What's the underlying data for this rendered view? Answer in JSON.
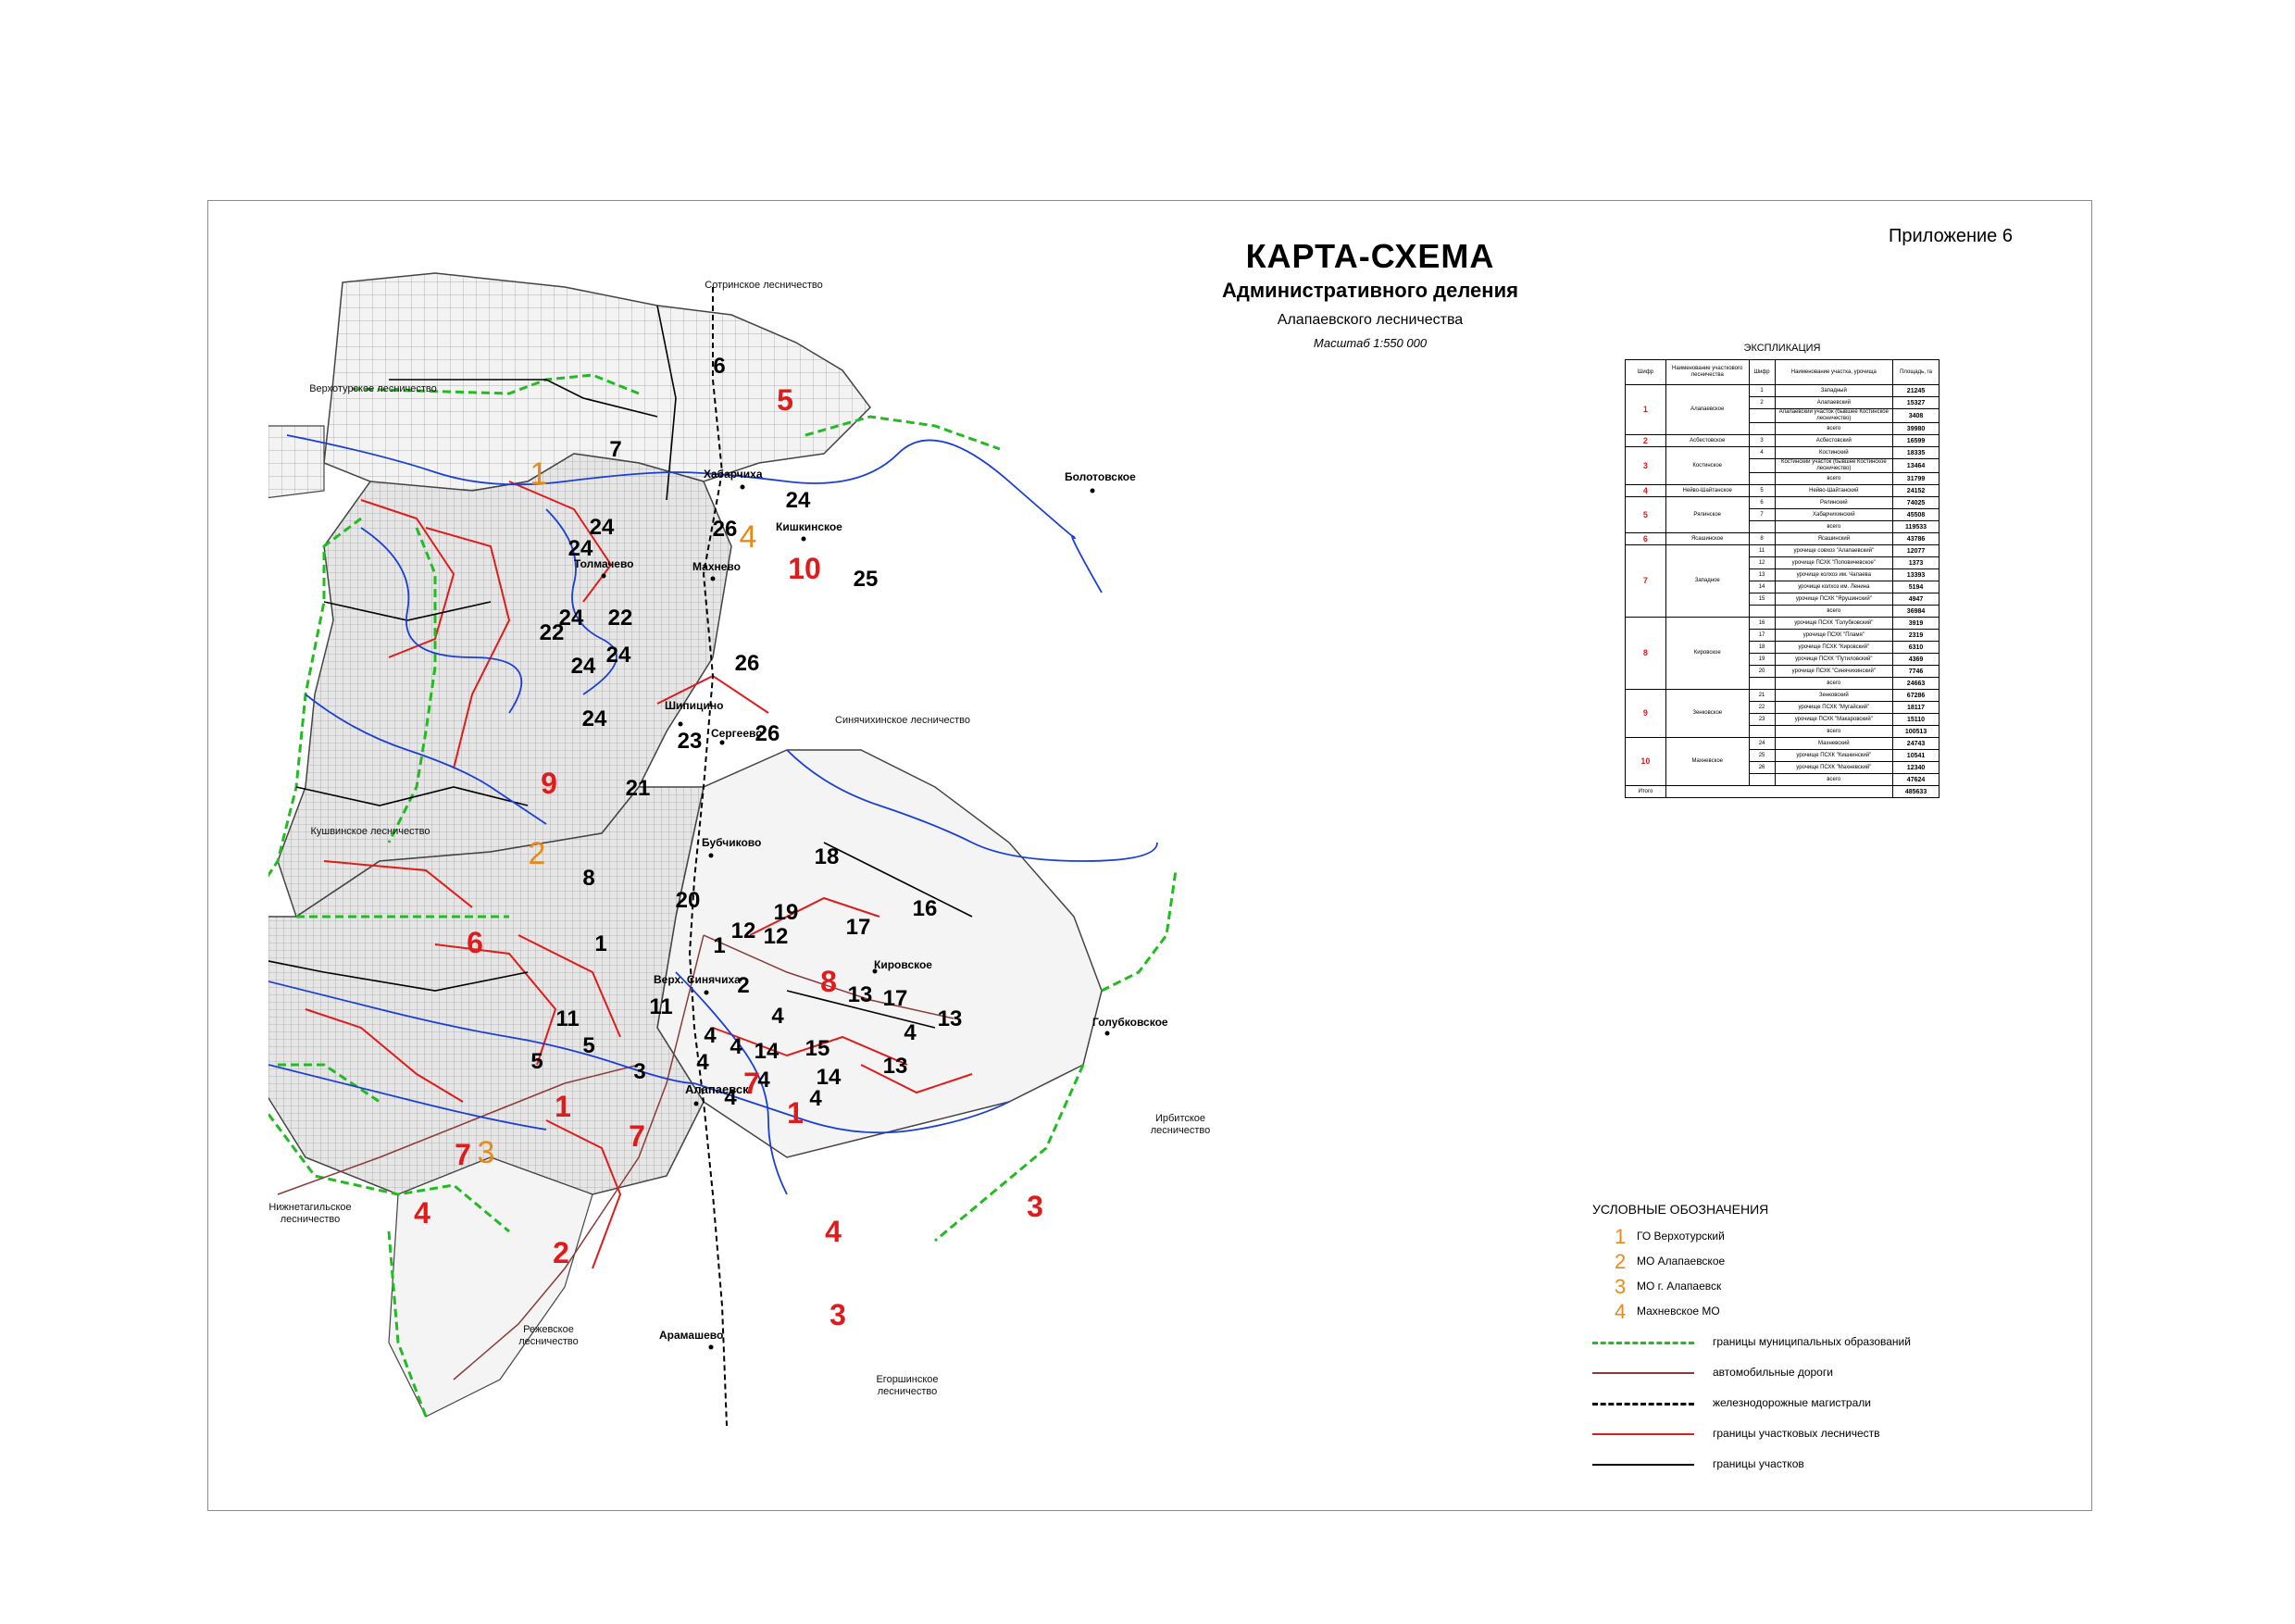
{
  "header": {
    "appendix": "Приложение 6",
    "title": "КАРТА-СХЕМА",
    "subtitle": "Административного деления",
    "subtitle2": "Алапаевского лесничества",
    "scale": "Масштаб 1:550 000"
  },
  "neighbors": [
    {
      "text": "Сотринское лесничество"
    },
    {
      "text": "Верхотурское лесничество"
    },
    {
      "text": "Кушвинское лесничество"
    },
    {
      "text": "Синячихинское лесничество"
    },
    {
      "text": "Ирбитское лесничество"
    },
    {
      "text": "Нижнетагильское лесничество"
    },
    {
      "text": "Режевское лесничество"
    },
    {
      "text": "Егоршинское лесничество"
    }
  ],
  "towns": [
    {
      "text": "Хабарчиха"
    },
    {
      "text": "Кишкинское"
    },
    {
      "text": "Болотовское"
    },
    {
      "text": "Толмачево"
    },
    {
      "text": "Махнево"
    },
    {
      "text": "Шипицино"
    },
    {
      "text": "Сергеево"
    },
    {
      "text": "Бубчиково"
    },
    {
      "text": "Верх. Синячиха"
    },
    {
      "text": "Кировское"
    },
    {
      "text": "Голубковское"
    },
    {
      "text": "Алапаевск"
    },
    {
      "text": "Арамашево"
    }
  ],
  "map_labels": {
    "municipal": [
      "1",
      "2",
      "3",
      "4"
    ],
    "forestries": [
      "1",
      "2",
      "3",
      "4",
      "5",
      "6",
      "7",
      "7",
      "7",
      "8",
      "9",
      "10",
      "1",
      "3",
      "4"
    ],
    "sections": [
      "6",
      "7",
      "24",
      "24",
      "24",
      "22",
      "22",
      "24",
      "24",
      "24",
      "26",
      "26",
      "24",
      "26",
      "23",
      "21",
      "8",
      "20",
      "18",
      "19",
      "16",
      "17",
      "12",
      "12",
      "1",
      "1",
      "2",
      "11",
      "11",
      "5",
      "5",
      "3",
      "4",
      "4",
      "4",
      "4",
      "4",
      "14",
      "15",
      "14",
      "4",
      "13",
      "17",
      "13",
      "13",
      "4",
      "4",
      "25"
    ]
  },
  "explication": {
    "title": "ЭКСПЛИКАЦИЯ",
    "headers": [
      "Шифр",
      "Наименование участкового лесничества",
      "Шифр",
      "Наименование участка, урочища",
      "Площадь, га"
    ],
    "groups": [
      {
        "cipher": "1",
        "name": "Алапаевское",
        "rows": [
          {
            "sub": "1",
            "name": "Западный",
            "area": "21245"
          },
          {
            "sub": "2",
            "name": "Алапаевский",
            "area": "15327"
          },
          {
            "sub": "",
            "name": "Алапаевский участок (бывшее Костинское лесничество)",
            "area": "3408"
          },
          {
            "sub": "",
            "name": "всего",
            "area": "39980"
          }
        ]
      },
      {
        "cipher": "2",
        "name": "Асбестовское",
        "rows": [
          {
            "sub": "3",
            "name": "Асбестовский",
            "area": "16599"
          }
        ]
      },
      {
        "cipher": "3",
        "name": "Костинское",
        "rows": [
          {
            "sub": "4",
            "name": "Костинский",
            "area": "18335"
          },
          {
            "sub": "",
            "name": "Костинский участок (бывшее Костинское лесничество)",
            "area": "13464"
          },
          {
            "sub": "",
            "name": "всего",
            "area": "31799"
          }
        ]
      },
      {
        "cipher": "4",
        "name": "Нейво-Шайтанское",
        "rows": [
          {
            "sub": "5",
            "name": "Нейво-Шайтанский",
            "area": "24152"
          }
        ]
      },
      {
        "cipher": "5",
        "name": "Рялинское",
        "rows": [
          {
            "sub": "6",
            "name": "Рялинский",
            "area": "74025"
          },
          {
            "sub": "7",
            "name": "Хабарчихинский",
            "area": "45508"
          },
          {
            "sub": "",
            "name": "всего",
            "area": "119533"
          }
        ]
      },
      {
        "cipher": "6",
        "name": "Ясашинское",
        "rows": [
          {
            "sub": "8",
            "name": "Ясашинский",
            "area": "43786"
          }
        ]
      },
      {
        "cipher": "7",
        "name": "Западное",
        "rows": [
          {
            "sub": "11",
            "name": "урочище совхоз \"Алапаевский\"",
            "area": "12077"
          },
          {
            "sub": "12",
            "name": "урочище ПСХК \"Поповичевское\"",
            "area": "1373"
          },
          {
            "sub": "13",
            "name": "урочище колхоз им. Чапаева",
            "area": "13393"
          },
          {
            "sub": "14",
            "name": "урочище колхоз им. Ленина",
            "area": "5194"
          },
          {
            "sub": "15",
            "name": "урочище ПСХК \"Ярушинский\"",
            "area": "4947"
          },
          {
            "sub": "",
            "name": "всего",
            "area": "36984"
          }
        ]
      },
      {
        "cipher": "8",
        "name": "Кировское",
        "rows": [
          {
            "sub": "16",
            "name": "урочище ПСХК \"Голубковский\"",
            "area": "3919"
          },
          {
            "sub": "17",
            "name": "урочище ПСХК \"Пламя\"",
            "area": "2319"
          },
          {
            "sub": "18",
            "name": "урочище ПСХК \"Кировский\"",
            "area": "6310"
          },
          {
            "sub": "19",
            "name": "урочище ПСХК \"Путиловский\"",
            "area": "4369"
          },
          {
            "sub": "20",
            "name": "урочище ПСХК \"Синячихинский\"",
            "area": "7746"
          },
          {
            "sub": "",
            "name": "всего",
            "area": "24663"
          }
        ]
      },
      {
        "cipher": "9",
        "name": "Зенковское",
        "rows": [
          {
            "sub": "21",
            "name": "Зенковский",
            "area": "67286"
          },
          {
            "sub": "22",
            "name": "урочище ПСХК \"Мугайский\"",
            "area": "18117"
          },
          {
            "sub": "23",
            "name": "урочище ПСХК \"Макаровский\"",
            "area": "15110"
          },
          {
            "sub": "",
            "name": "всего",
            "area": "100513"
          }
        ]
      },
      {
        "cipher": "10",
        "name": "Махневское",
        "rows": [
          {
            "sub": "24",
            "name": "Махневский",
            "area": "24743"
          },
          {
            "sub": "25",
            "name": "урочище ПСХК \"Кишкинский\"",
            "area": "10541"
          },
          {
            "sub": "26",
            "name": "урочище ПСХК \"Махневский\"",
            "area": "12340"
          },
          {
            "sub": "",
            "name": "всего",
            "area": "47624"
          }
        ]
      }
    ],
    "total_label": "Итого",
    "total_area": "485633"
  },
  "legend": {
    "title": "УСЛОВНЫЕ ОБОЗНАЧЕНИЯ",
    "municipal": [
      {
        "num": "1",
        "text": "ГО Верхотурский"
      },
      {
        "num": "2",
        "text": "МО Алапаевское"
      },
      {
        "num": "3",
        "text": "МО г. Алапаевск"
      },
      {
        "num": "4",
        "text": "Махневское МО"
      }
    ],
    "lines": [
      {
        "text": "границы муниципальных образований",
        "color": "#22bb22",
        "style": "dashed"
      },
      {
        "text": "автомобильные дороги",
        "color": "#8b3a3a",
        "style": "solid"
      },
      {
        "text": "железнодорожные магистрали",
        "color": "#000000",
        "style": "dashed"
      },
      {
        "text": "границы участковых лесничеств",
        "color": "#e01b1b",
        "style": "solid"
      },
      {
        "text": "границы участков",
        "color": "#000000",
        "style": "solid"
      }
    ]
  },
  "colors": {
    "municipal_num": "#e88a1a",
    "forestry_num": "#e01b1b",
    "river": "#1a3fd6",
    "boundary_green": "#22bb22"
  }
}
